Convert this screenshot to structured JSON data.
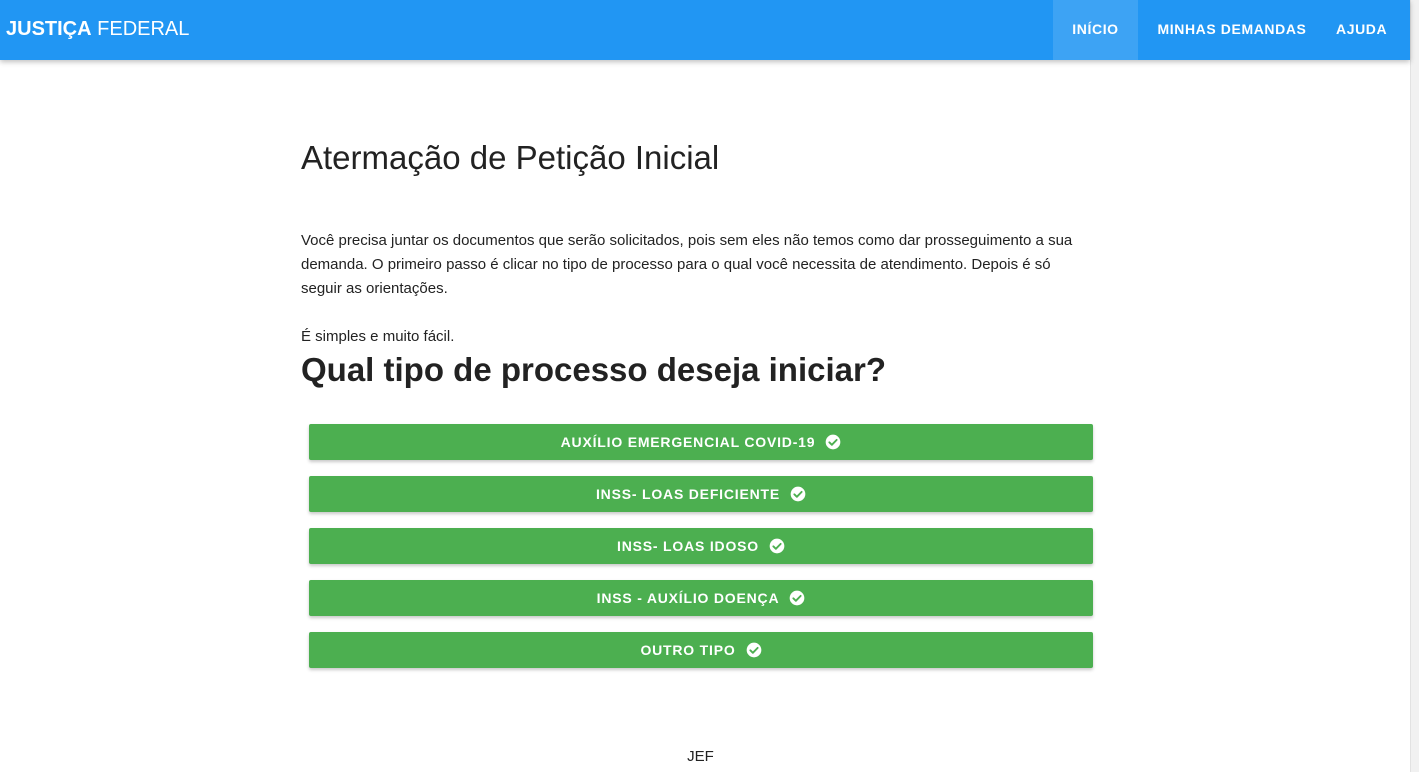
{
  "header": {
    "brand_bold": "JUSTIÇA",
    "brand_light": " FEDERAL",
    "nav": [
      {
        "label": "INÍCIO",
        "active": true
      },
      {
        "label": "MINHAS DEMANDAS",
        "active": false
      },
      {
        "label": "AJUDA",
        "active": false
      }
    ],
    "color": "#2196f3"
  },
  "main": {
    "title": "Atermação de Petição Inicial",
    "intro": "Você precisa juntar os documentos que serão solicitados, pois sem eles não temos como dar prosseguimento a sua demanda. O primeiro passo é clicar no tipo de processo para o qual você necessita de atendimento. Depois é só seguir as orientações.",
    "simple": "É simples e muito fácil.",
    "question": "Qual tipo de processo deseja iniciar?",
    "options": [
      {
        "label": "AUXÍLIO EMERGENCIAL COVID-19",
        "icon": "check-circle-icon"
      },
      {
        "label": "INSS- LOAS DEFICIENTE",
        "icon": "check-circle-icon"
      },
      {
        "label": "INSS- LOAS IDOSO",
        "icon": "check-circle-icon"
      },
      {
        "label": "INSS - AUXÍLIO DOENÇA",
        "icon": "check-circle-icon"
      },
      {
        "label": "OUTRO TIPO",
        "icon": "check-circle-icon"
      }
    ],
    "button_color": "#4caf50"
  },
  "footer": {
    "text": "JEF"
  }
}
